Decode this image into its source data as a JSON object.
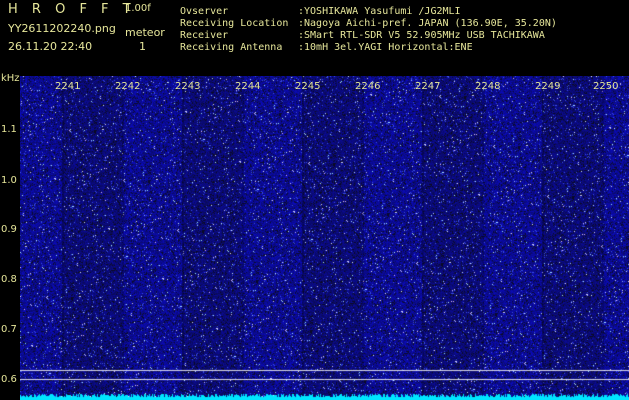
{
  "header": {
    "app_title": "H R O F F T",
    "version": "1.00f",
    "file_name": "YY2611202240.png",
    "timestamp": "26.11.20 22:40",
    "meteor_label": "meteor",
    "meteor_count": "1"
  },
  "info": {
    "observer_label": "Ovserver",
    "observer_value": ":YOSHIKAWA Yasufumi /JG2MLI",
    "location_label": "Receiving Location",
    "location_value": ":Nagoya Aichi-pref. JAPAN (136.90E, 35.20N)",
    "receiver_label": "Receiver",
    "receiver_value": ":SMart RTL-SDR V5 52.905MHz USB TACHIKAWA",
    "antenna_label": "Receiving Antenna",
    "antenna_value": ":10mH 3el.YAGI Horizontal:ENE"
  },
  "axes": {
    "y_unit": "kHz",
    "y_ticks": [
      "1.1",
      "1.0",
      "0.9",
      "0.8",
      "0.7",
      "0.6"
    ],
    "x_ticks": [
      "2241",
      "2242",
      "2243",
      "2244",
      "2245",
      "2246",
      "2247",
      "2248",
      "2249",
      "2250"
    ]
  },
  "colors": {
    "background": "#000000",
    "text": "#e6e69a",
    "waterfall_base": "#1a1aa0",
    "signal_line": "#00e5ff",
    "guide_line": "#ffffff"
  }
}
